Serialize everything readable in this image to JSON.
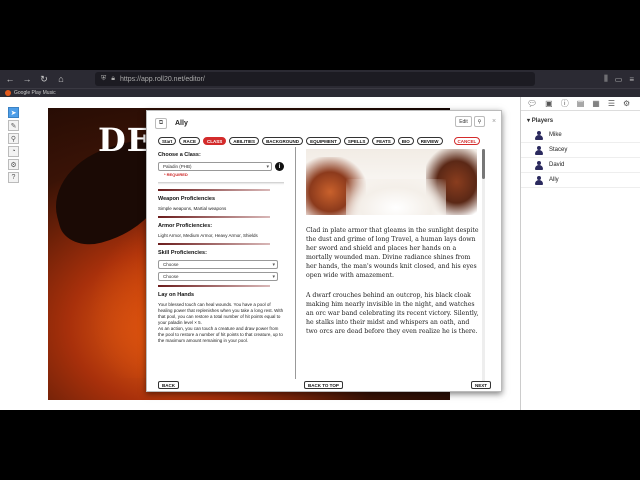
{
  "browser": {
    "url": "https://app.roll20.net/editor/",
    "bookmark": "Google Play Music"
  },
  "canvas": {
    "title_text": "DES"
  },
  "right_panel": {
    "header": "Players",
    "players": [
      "Mike",
      "Stacey",
      "David",
      "Ally"
    ]
  },
  "dialog": {
    "title": "Ally",
    "edit_label": "Edit",
    "tabs": [
      "Start",
      "RACE",
      "CLASS",
      "ABILITIES",
      "BACKGROUND",
      "EQUIPMENT",
      "SPELLS",
      "FEATS",
      "BIO",
      "REVIEW"
    ],
    "cancel_label": "CANCEL",
    "class_section": {
      "heading": "Choose a Class:",
      "selected": "Paladin (PHB)",
      "required": "* REQUIRED"
    },
    "weapon": {
      "heading": "Weapon Proficiencies",
      "text": "Simple weapons, Martial weapons"
    },
    "armor": {
      "heading": "Armor Proficiencies:",
      "text": "Light Armor, Medium Armor, Heavy Armor, Shields"
    },
    "skill": {
      "heading": "Skill Proficiencies:",
      "choose1": "Choose",
      "choose2": "Choose"
    },
    "lay_on_hands": {
      "heading": "Lay on Hands",
      "p1": "Your blessed touch can heal wounds. You have a pool of healing power that replenishes when you take a long rest. With that pool, you can restore a total number of hit points equal to your paladin level × 5.",
      "p2": "As an action, you can touch a creature and draw power from the pool to restore a number of hit points to that creature, up to the maximum amount remaining in your pool."
    },
    "lore": {
      "p1": "Clad in plate armor that gleams in the sunlight despite the dust and grime of long Travel, a human lays down her sword and shield and places her hands on a mortally wounded man. Divine radiance shines from her hands, the man's wounds knit closed, and his eyes open wide with amazement.",
      "p2": "A dwarf crouches behind an outcrop, his black cloak making him nearly invisible in the night, and watches an orc war band celebrating its recent victory. Silently, he stalks into their midst and whispers an oath, and two orcs are dead before they even realize he is there."
    },
    "footer": {
      "back": "BACK",
      "back_to_top": "BACK TO TOP",
      "next": "NEXT"
    }
  }
}
